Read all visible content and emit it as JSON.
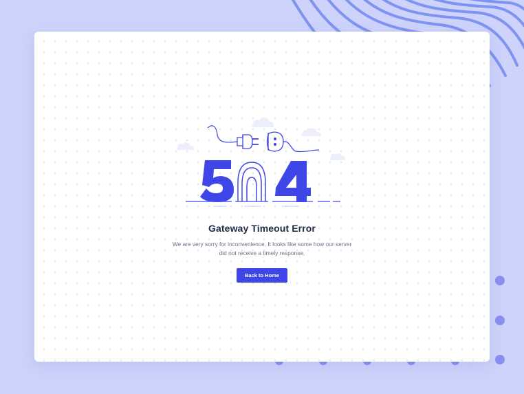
{
  "error_page": {
    "code": "504",
    "title": "Gateway Timeout Error",
    "message_line1": "We are very sorry for inconvenience. It looks like some how our server",
    "message_line2": "did not receive a timely response.",
    "button_label": "Back to Home"
  },
  "colors": {
    "background": "#cdd3fb",
    "card": "#ffffff",
    "accent": "#3f46e8",
    "decor_lines": "#7f93f0",
    "decor_dots": "#8b8ff0",
    "heading": "#1f2a44",
    "body_text": "#6b7186"
  },
  "icons": [
    "plug-icon",
    "socket-icon",
    "cloud-icon"
  ]
}
